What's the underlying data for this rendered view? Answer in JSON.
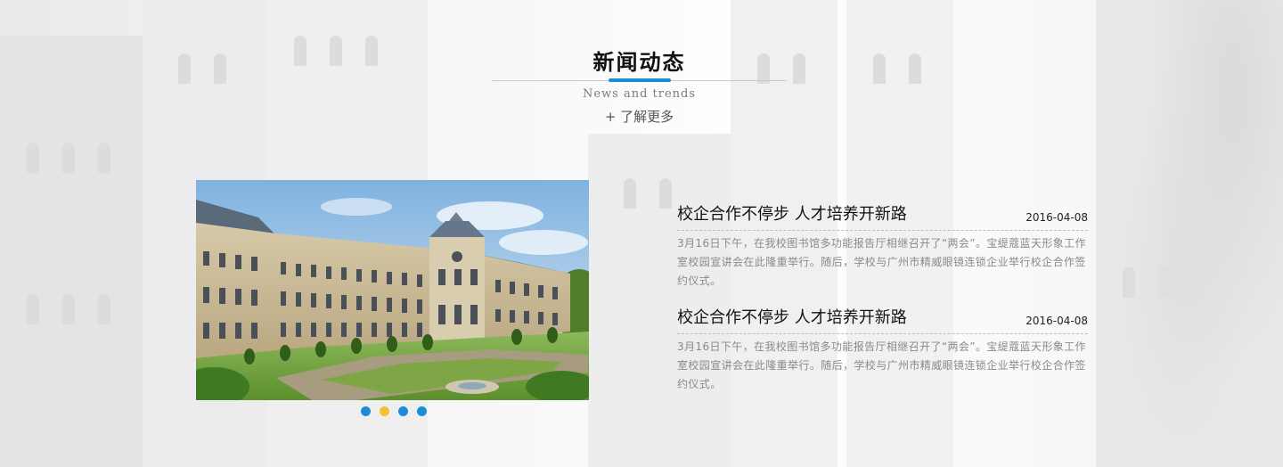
{
  "section": {
    "title": "新闻动态",
    "subtitle": "News and trends",
    "more_link": "+ 了解更多",
    "accent_color": "#1a8cd8"
  },
  "carousel": {
    "image_alt_icon": "palace-photo",
    "dots": [
      {
        "active": false
      },
      {
        "active": true
      },
      {
        "active": false
      },
      {
        "active": false
      }
    ],
    "dot_color": "#1a8cd8",
    "active_dot_color": "#f2c12e"
  },
  "news": [
    {
      "title": "校企合作不停步 人才培养开新路",
      "date": "2016-04-08",
      "summary": "3月16日下午，在我校图书馆多功能报告厅相继召开了“两会”。宝缇蔻蓝天形象工作室校园宣讲会在此隆重举行。随后，学校与广州市精威眼镜连锁企业举行校企合作签约仪式。"
    },
    {
      "title": "校企合作不停步 人才培养开新路",
      "date": "2016-04-08",
      "summary": "3月16日下午，在我校图书馆多功能报告厅相继召开了“两会”。宝缇蔻蓝天形象工作室校园宣讲会在此隆重举行。随后，学校与广州市精威眼镜连锁企业举行校企合作签约仪式。"
    }
  ]
}
